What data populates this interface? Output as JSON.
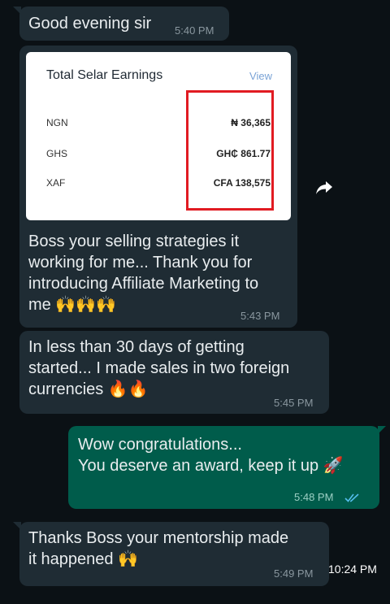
{
  "messages": [
    {
      "text": "Good evening sir",
      "time": "5:40 PM"
    },
    {
      "card": {
        "title": "Total Selar Earnings",
        "view_label": "View",
        "rows": [
          {
            "currency": "NGN",
            "amount": "₦ 36,365"
          },
          {
            "currency": "GHS",
            "amount": "GH₵ 861.77"
          },
          {
            "currency": "XAF",
            "amount": "CFA 138,575"
          }
        ],
        "highlight_color": "#e11b22"
      },
      "lines": [
        "Boss your selling strategies it",
        "working for me... Thank you for",
        "introducing Affiliate Marketing to",
        "me "
      ],
      "emoji": "🙌🙌🙌",
      "time": "5:43 PM"
    },
    {
      "lines": [
        "In less than 30 days of getting",
        "started... I made sales in two foreign",
        "currencies "
      ],
      "emoji": "🔥🔥",
      "time": "5:45 PM"
    },
    {
      "lines": [
        "Wow congratulations...",
        "You deserve an award, keep it up "
      ],
      "emoji": "🚀",
      "time": "5:48 PM",
      "status_icon": "double-check-icon"
    },
    {
      "lines": [
        "Thanks Boss your mentorship made",
        "it happened "
      ],
      "emoji": "🙌",
      "time": "5:49 PM"
    }
  ],
  "status_bar_time": "10:24 PM",
  "colors": {
    "background": "#0b1115",
    "incoming_bubble": "#1f2c34",
    "outgoing_bubble": "#005c4b",
    "read_tick": "#53bdeb"
  }
}
